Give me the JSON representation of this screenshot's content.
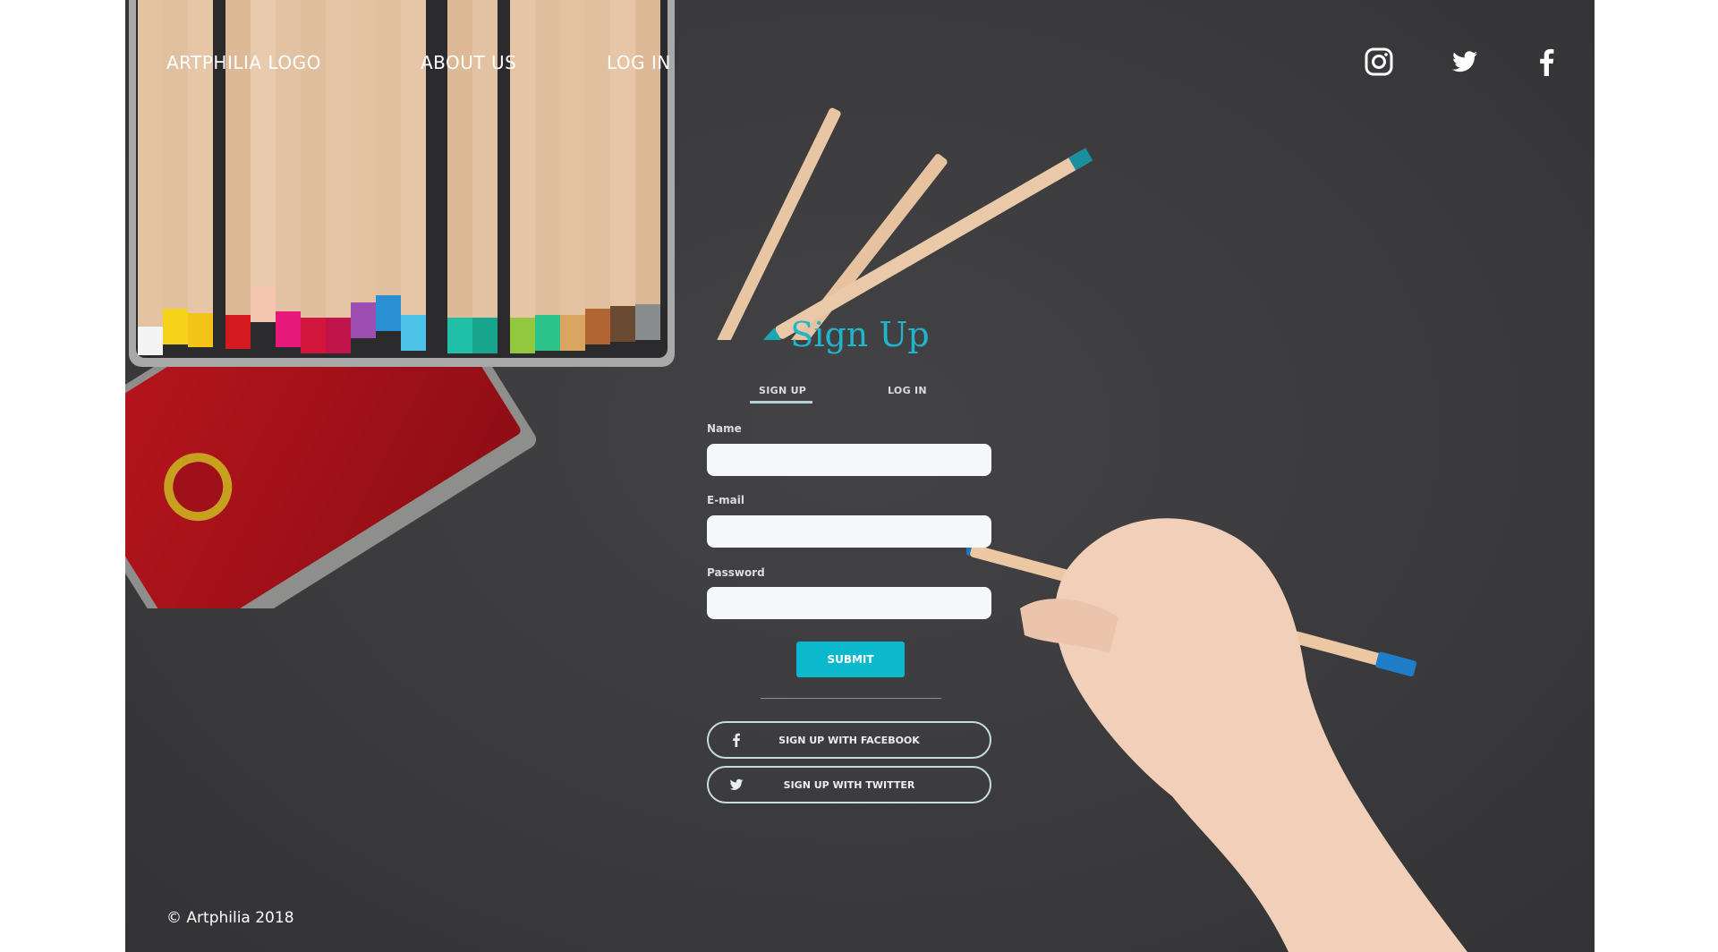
{
  "header": {
    "logo": "ARTPHILIA LOGO",
    "nav": {
      "about": "ABOUT US",
      "login": "LOG IN"
    },
    "social_icons": [
      "instagram-icon",
      "twitter-icon",
      "facebook-icon"
    ]
  },
  "form": {
    "title": "Sign Up",
    "tabs": {
      "signup": "SIGN UP",
      "login": "LOG IN",
      "active": "SIGN UP"
    },
    "fields": {
      "name_label": "Name",
      "email_label": "E-mail",
      "password_label": "Password",
      "name_value": "",
      "email_value": "",
      "password_value": ""
    },
    "submit_label": "SUBMIT",
    "facebook_label": "SIGN UP WITH FACEBOOK",
    "twitter_label": "SIGN UP WITH TWITTER"
  },
  "footer": {
    "copyright": "© Artphilia 2018"
  },
  "colors": {
    "accent": "#0bb8cc",
    "background": "#3c3c3e",
    "text": "#ffffff"
  }
}
